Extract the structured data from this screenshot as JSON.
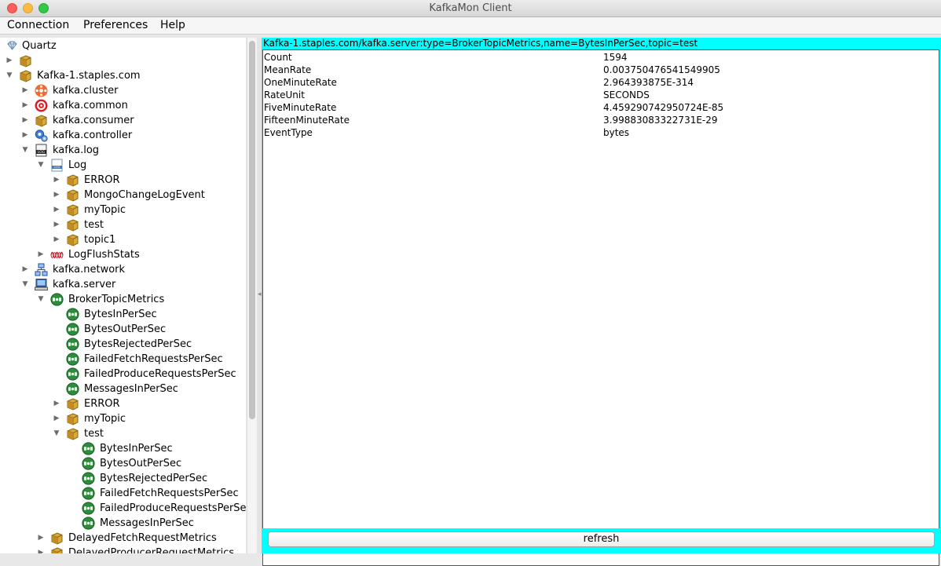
{
  "window": {
    "title": "KafkaMon Client"
  },
  "menu": [
    "Connection",
    "Preferences",
    "Help"
  ],
  "tree": [
    {
      "label": "Quartz",
      "icon": "diamond-icon",
      "toggle": ""
    },
    {
      "label": "",
      "icon": "package-icon",
      "toggle": "▶"
    },
    {
      "label": "Kafka-1.staples.com",
      "icon": "package-icon",
      "toggle": "▼"
    },
    {
      "label": "kafka.cluster",
      "icon": "cluster-icon",
      "toggle": "▶"
    },
    {
      "label": "kafka.common",
      "icon": "target-icon",
      "toggle": "▶"
    },
    {
      "label": "kafka.consumer",
      "icon": "package-icon",
      "toggle": "▶"
    },
    {
      "label": "kafka.controller",
      "icon": "controller-gear-icon",
      "toggle": "▶"
    },
    {
      "label": "kafka.log",
      "icon": "log-document-icon",
      "toggle": "▼"
    },
    {
      "label": "Log",
      "icon": "log-file-icon",
      "toggle": "▼"
    },
    {
      "label": "ERROR",
      "icon": "package-icon",
      "toggle": "▶"
    },
    {
      "label": "MongoChangeLogEvent",
      "icon": "package-icon",
      "toggle": "▶"
    },
    {
      "label": "myTopic",
      "icon": "package-icon",
      "toggle": "▶"
    },
    {
      "label": "test",
      "icon": "package-icon",
      "toggle": "▶"
    },
    {
      "label": "topic1",
      "icon": "package-icon",
      "toggle": "▶"
    },
    {
      "label": "LogFlushStats",
      "icon": "waveform-icon",
      "toggle": "▶"
    },
    {
      "label": "kafka.network",
      "icon": "network-icon",
      "toggle": "▶"
    },
    {
      "label": "kafka.server",
      "icon": "computer-icon",
      "toggle": "▼"
    },
    {
      "label": "BrokerTopicMetrics",
      "icon": "metric-icon",
      "toggle": "▼"
    },
    {
      "label": "BytesInPerSec",
      "icon": "metric-icon",
      "toggle": ""
    },
    {
      "label": "BytesOutPerSec",
      "icon": "metric-icon",
      "toggle": ""
    },
    {
      "label": "BytesRejectedPerSec",
      "icon": "metric-icon",
      "toggle": ""
    },
    {
      "label": "FailedFetchRequestsPerSec",
      "icon": "metric-icon",
      "toggle": ""
    },
    {
      "label": "FailedProduceRequestsPerSec",
      "icon": "metric-icon",
      "toggle": ""
    },
    {
      "label": "MessagesInPerSec",
      "icon": "metric-icon",
      "toggle": ""
    },
    {
      "label": "ERROR",
      "icon": "package-icon",
      "toggle": "▶"
    },
    {
      "label": "myTopic",
      "icon": "package-icon",
      "toggle": "▶"
    },
    {
      "label": "test",
      "icon": "package-icon",
      "toggle": "▼"
    },
    {
      "label": "BytesInPerSec",
      "icon": "metric-icon",
      "toggle": ""
    },
    {
      "label": "BytesOutPerSec",
      "icon": "metric-icon",
      "toggle": ""
    },
    {
      "label": "BytesRejectedPerSec",
      "icon": "metric-icon",
      "toggle": ""
    },
    {
      "label": "FailedFetchRequestsPerSec",
      "icon": "metric-icon",
      "toggle": ""
    },
    {
      "label": "FailedProduceRequestsPerSec",
      "icon": "metric-icon",
      "toggle": ""
    },
    {
      "label": "MessagesInPerSec",
      "icon": "metric-icon",
      "toggle": ""
    },
    {
      "label": "DelayedFetchRequestMetrics",
      "icon": "package-icon",
      "toggle": "▶"
    },
    {
      "label": "DelayedProducerRequestMetrics",
      "icon": "package-icon",
      "toggle": "▶"
    }
  ],
  "details": {
    "title": "Kafka-1.staples.com/kafka.server:type=BrokerTopicMetrics,name=BytesInPerSec,topic=test",
    "rows": [
      {
        "key": "Count",
        "value": "1594"
      },
      {
        "key": "MeanRate",
        "value": "0.003750476541549905"
      },
      {
        "key": "OneMinuteRate",
        "value": "2.964393875E-314"
      },
      {
        "key": "RateUnit",
        "value": "SECONDS"
      },
      {
        "key": "FiveMinuteRate",
        "value": "4.459290742950724E-85"
      },
      {
        "key": "FifteenMinuteRate",
        "value": "3.99883083322731E-29"
      },
      {
        "key": "EventType",
        "value": "bytes"
      }
    ]
  },
  "refresh_label": "refresh",
  "colors": {
    "highlight": "#00ffff",
    "metric_green": "#2e8b3c",
    "package_gold": "#d9a93a"
  }
}
